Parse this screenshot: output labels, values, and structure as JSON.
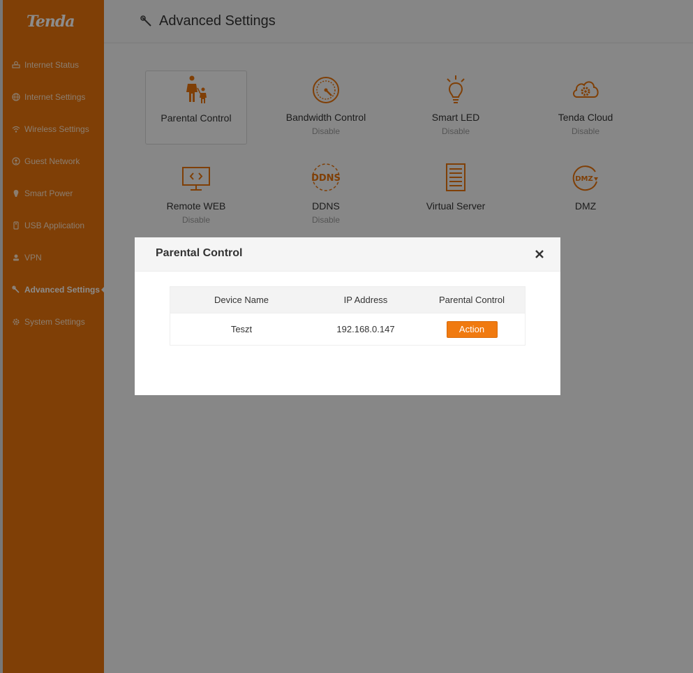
{
  "brand": {
    "logo_text": "Tenda",
    "accent": "#e8730c"
  },
  "sidebar": {
    "items": [
      {
        "label": "Internet Status",
        "icon": "globe-network-icon"
      },
      {
        "label": "Internet Settings",
        "icon": "globe-icon"
      },
      {
        "label": "Wireless Settings",
        "icon": "wifi-icon"
      },
      {
        "label": "Guest Network",
        "icon": "guest-icon"
      },
      {
        "label": "Smart Power",
        "icon": "power-icon"
      },
      {
        "label": "USB Application",
        "icon": "usb-icon"
      },
      {
        "label": "VPN",
        "icon": "vpn-icon"
      },
      {
        "label": "Advanced Settings",
        "icon": "wrench-icon",
        "active": true
      },
      {
        "label": "System Settings",
        "icon": "gear-icon"
      }
    ]
  },
  "header": {
    "title": "Advanced Settings"
  },
  "tiles": [
    {
      "label": "Parental Control",
      "status": "",
      "icon": "parent-child-icon"
    },
    {
      "label": "Bandwidth Control",
      "status": "Disable",
      "icon": "speedometer-icon"
    },
    {
      "label": "Smart LED",
      "status": "Disable",
      "icon": "lightbulb-icon"
    },
    {
      "label": "Tenda Cloud",
      "status": "Disable",
      "icon": "cloud-gear-icon"
    },
    {
      "label": "Remote WEB",
      "status": "Disable",
      "icon": "monitor-code-icon"
    },
    {
      "label": "DDNS",
      "status": "Disable",
      "icon": "ddns-icon"
    },
    {
      "label": "Virtual Server",
      "status": "",
      "icon": "server-rack-icon"
    },
    {
      "label": "DMZ",
      "status": "",
      "icon": "dmz-icon"
    }
  ],
  "modal": {
    "title": "Parental Control",
    "columns": [
      "Device Name",
      "IP Address",
      "Parental Control"
    ],
    "rows": [
      {
        "device": "Teszt",
        "ip": "192.168.0.147",
        "action_label": "Action"
      }
    ]
  }
}
